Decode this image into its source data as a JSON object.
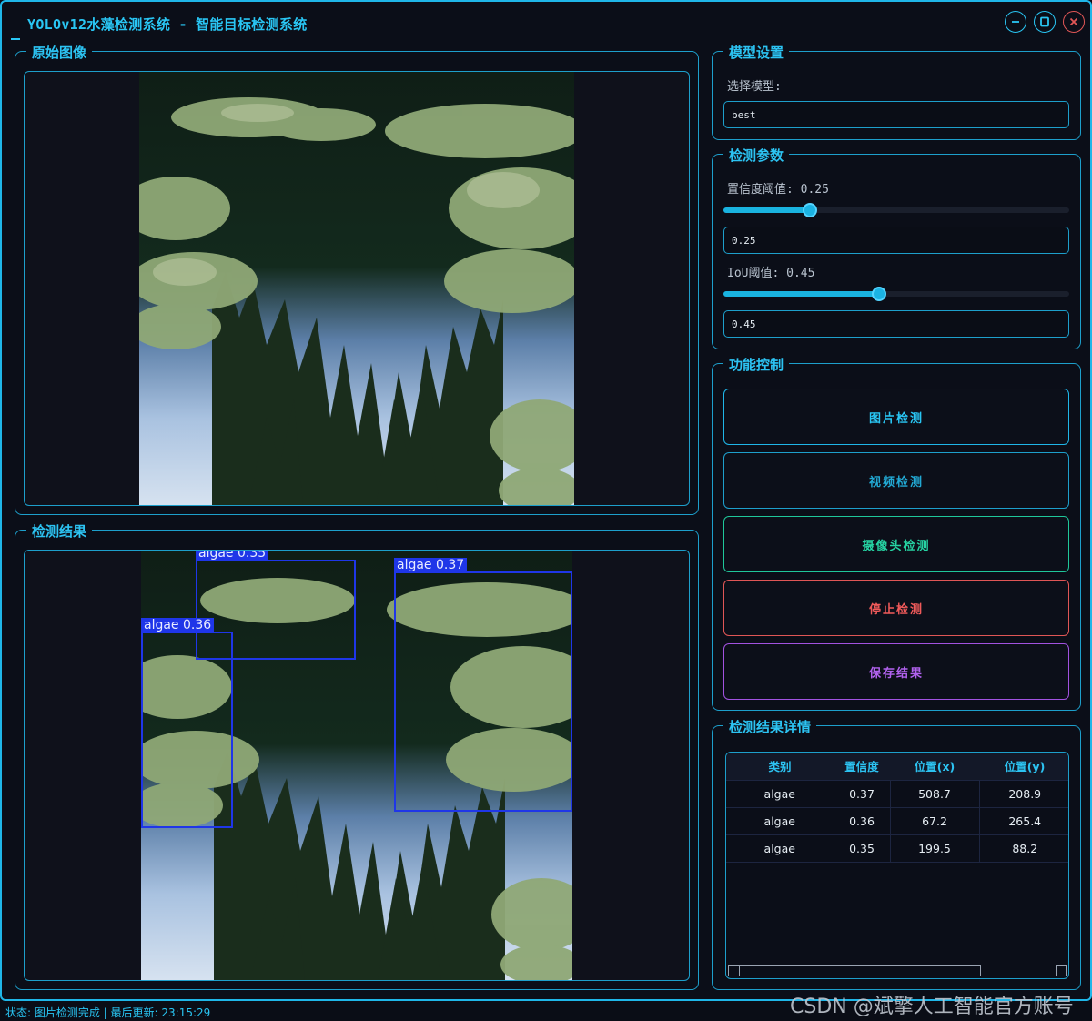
{
  "window": {
    "title": "YOLOv12水藻检测系统 - 智能目标检测系统",
    "buttons": [
      "minimize",
      "maximize",
      "close"
    ]
  },
  "original_image": {
    "title": "原始图像"
  },
  "detection_result": {
    "title": "检测结果",
    "detections": [
      {
        "label": "algae 0.35"
      },
      {
        "label": "algae 0.36"
      },
      {
        "label": "algae 0.37"
      }
    ]
  },
  "model_settings": {
    "title": "模型设置",
    "select_label": "选择模型:",
    "selected_model": "best"
  },
  "detect_params": {
    "title": "检测参数",
    "confidence_label": "置信度阈值: 0.25",
    "confidence_value": "0.25",
    "confidence_fraction": 0.25,
    "iou_label": "IoU阈值: 0.45",
    "iou_value": "0.45",
    "iou_fraction": 0.45
  },
  "controls": {
    "title": "功能控制",
    "image_detect": "图片检测",
    "video_detect": "视频检测",
    "camera_detect": "摄像头检测",
    "stop_detect": "停止检测",
    "save_result": "保存结果"
  },
  "colors": {
    "accent": "#29c6f4",
    "image_btn": "#1fb6e8",
    "video_btn": "#1d9fcb",
    "camera_btn": "#1fc79a",
    "stop_btn": "#e05656",
    "save_btn": "#a252e0"
  },
  "results_table": {
    "title": "检测结果详情",
    "headers": [
      "类别",
      "置信度",
      "位置(x)",
      "位置(y)"
    ],
    "rows": [
      [
        "algae",
        "0.37",
        "508.7",
        "208.9"
      ],
      [
        "algae",
        "0.36",
        "67.2",
        "265.4"
      ],
      [
        "algae",
        "0.35",
        "199.5",
        "88.2"
      ]
    ]
  },
  "status": {
    "text": "状态: 图片检测完成 | 最后更新: 23:15:29"
  },
  "watermark": "CSDN @斌擎人工智能官方账号"
}
